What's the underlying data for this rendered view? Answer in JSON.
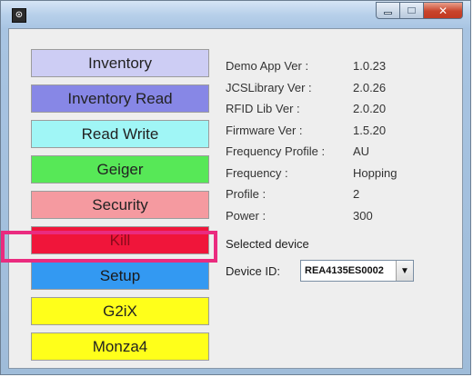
{
  "window": {
    "icon_glyph": "⊙",
    "controls": {
      "minimize": "–",
      "close": "✕"
    }
  },
  "nav": [
    {
      "label": "Inventory",
      "color": "#cdcdf4",
      "text_color": "#222222"
    },
    {
      "label": "Inventory Read",
      "color": "#8787e6",
      "text_color": "#222222"
    },
    {
      "label": "Read Write",
      "color": "#a0f6f6",
      "text_color": "#222222"
    },
    {
      "label": "Geiger",
      "color": "#57e857",
      "text_color": "#222222"
    },
    {
      "label": "Security",
      "color": "#f59aa0",
      "text_color": "#222222"
    },
    {
      "label": "Kill",
      "color": "#f0153a",
      "text_color": "#8a0a1c"
    },
    {
      "label": "Setup",
      "color": "#3399f2",
      "text_color": "#1a1a1a"
    },
    {
      "label": "G2iX",
      "color": "#ffff1a",
      "text_color": "#222222"
    },
    {
      "label": "Monza4",
      "color": "#ffff1a",
      "text_color": "#222222"
    }
  ],
  "highlight_color": "#ea2b7f",
  "info": [
    {
      "label": "Demo App Ver :",
      "value": "1.0.23"
    },
    {
      "label": "JCSLibrary Ver :",
      "value": "2.0.26"
    },
    {
      "label": "RFID Lib Ver :",
      "value": "2.0.20"
    },
    {
      "label": "Firmware Ver :",
      "value": "1.5.20"
    },
    {
      "label": "Frequency Profile :",
      "value": "AU"
    },
    {
      "label": "Frequency :",
      "value": "Hopping"
    },
    {
      "label": "Profile :",
      "value": "2"
    },
    {
      "label": "Power :",
      "value": "300"
    }
  ],
  "selected_device_label": "Selected device",
  "device_id_label": "Device ID:",
  "device_id_value": "REA4135ES0002",
  "dropdown_arrow": "▼"
}
